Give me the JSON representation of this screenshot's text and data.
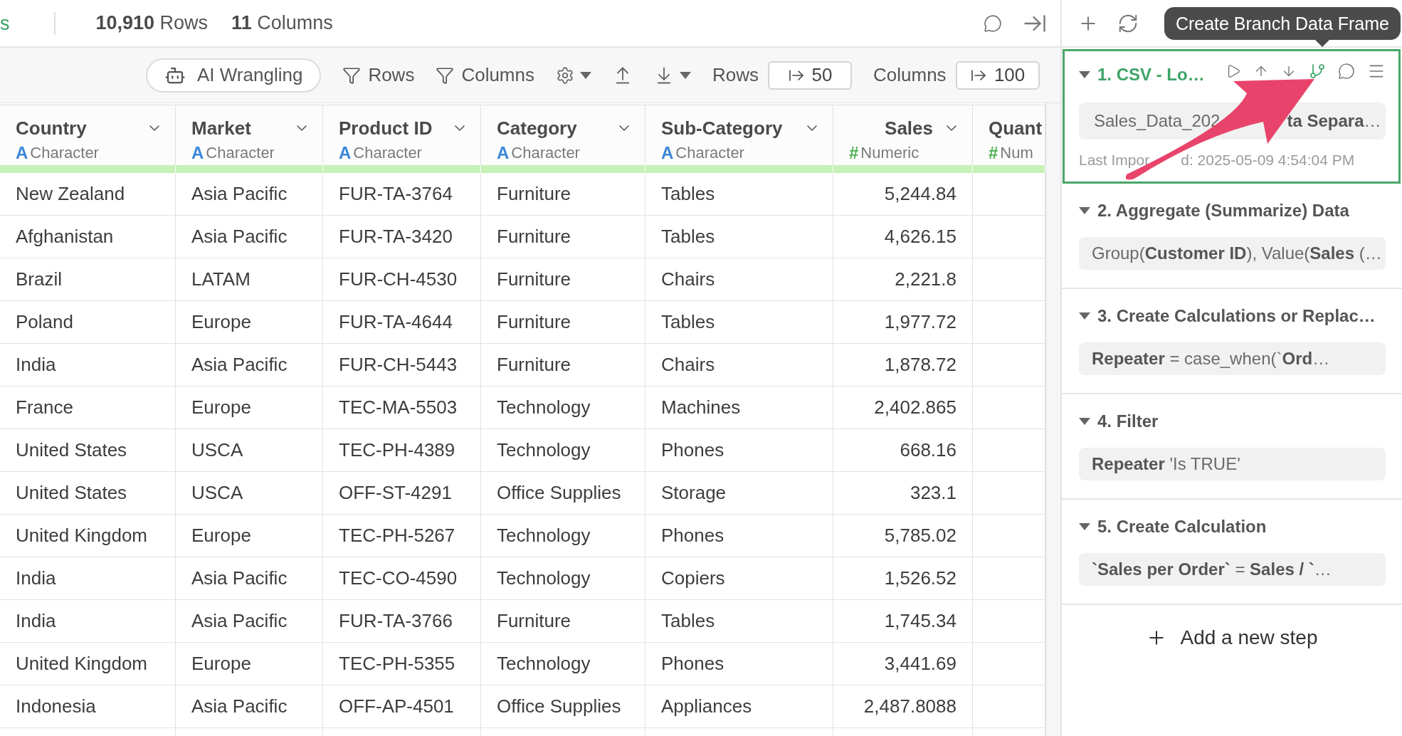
{
  "top_bar": {
    "cut_tab_label": "s",
    "rows": "**10,910** Rows",
    "columns": "**11** Columns"
  },
  "toolbar": {
    "ai_button": "AI Wrangling",
    "row_filter": "Rows",
    "column_filter": "Columns",
    "rows_limit_label": "Rows",
    "rows_limit": "50",
    "columns_limit_label": "Columns",
    "columns_limit": "100"
  },
  "table": {
    "columns": [
      {
        "name": "Country",
        "type": "Character",
        "symbol": "A",
        "kind": "character",
        "menu": true
      },
      {
        "name": "Market",
        "type": "Character",
        "symbol": "A",
        "kind": "character",
        "menu": true
      },
      {
        "name": "Product ID",
        "type": "Character",
        "symbol": "A",
        "kind": "character",
        "menu": true
      },
      {
        "name": "Category",
        "type": "Character",
        "symbol": "A",
        "kind": "character",
        "menu": true
      },
      {
        "name": "Sub-Category",
        "type": "Character",
        "symbol": "A",
        "kind": "character",
        "menu": true
      },
      {
        "name": "Sales",
        "type": "Numeric",
        "symbol": "#",
        "kind": "numeric",
        "menu": true
      },
      {
        "name": "Quant",
        "type": "Num",
        "symbol": "#",
        "kind": "numeric",
        "menu": false
      }
    ],
    "rows": [
      [
        "New Zealand",
        "Asia Pacific",
        "FUR-TA-3764",
        "Furniture",
        "Tables",
        "5,244.84"
      ],
      [
        "Afghanistan",
        "Asia Pacific",
        "FUR-TA-3420",
        "Furniture",
        "Tables",
        "4,626.15"
      ],
      [
        "Brazil",
        "LATAM",
        "FUR-CH-4530",
        "Furniture",
        "Chairs",
        "2,221.8"
      ],
      [
        "Poland",
        "Europe",
        "FUR-TA-4644",
        "Furniture",
        "Tables",
        "1,977.72"
      ],
      [
        "India",
        "Asia Pacific",
        "FUR-CH-5443",
        "Furniture",
        "Chairs",
        "1,878.72"
      ],
      [
        "France",
        "Europe",
        "TEC-MA-5503",
        "Technology",
        "Machines",
        "2,402.865"
      ],
      [
        "United States",
        "USCA",
        "TEC-PH-4389",
        "Technology",
        "Phones",
        "668.16"
      ],
      [
        "United States",
        "USCA",
        "OFF-ST-4291",
        "Office Supplies",
        "Storage",
        "323.1"
      ],
      [
        "United Kingdom",
        "Europe",
        "TEC-PH-5267",
        "Technology",
        "Phones",
        "5,785.02"
      ],
      [
        "India",
        "Asia Pacific",
        "TEC-CO-4590",
        "Technology",
        "Copiers",
        "1,526.52"
      ],
      [
        "India",
        "Asia Pacific",
        "FUR-TA-3766",
        "Furniture",
        "Tables",
        "1,745.34"
      ],
      [
        "United Kingdom",
        "Europe",
        "TEC-PH-5355",
        "Technology",
        "Phones",
        "3,441.69"
      ],
      [
        "Indonesia",
        "Asia Pacific",
        "OFF-AP-4501",
        "Office Supplies",
        "Appliances",
        "2,487.8088"
      ]
    ]
  },
  "steps_panel": {
    "tooltip": "Create Branch Data Frame",
    "steps": [
      {
        "title": "1. CSV - Lo…",
        "expanded": true,
        "selected": true,
        "summary_parts": [
          "Sales_Data_202",
          "**ta Separa**…"
        ],
        "meta_parts": [
          "Last Impor",
          "d: 2025-05-09 4:54:04 PM"
        ]
      },
      {
        "title": "2. Aggregate (Summarize) Data",
        "expanded": true,
        "selected": false,
        "summary_parts": [
          "Group(**Customer ID**), Value(**Sales** (…"
        ]
      },
      {
        "title": "3. Create Calculations or Replac…",
        "expanded": true,
        "selected": false,
        "summary_parts": [
          "**Repeater** = case_when(`**Ord**…"
        ]
      },
      {
        "title": "4. Filter",
        "expanded": true,
        "selected": false,
        "summary_parts": [
          "**Repeater** 'Is TRUE'"
        ]
      },
      {
        "title": "5. Create Calculation",
        "expanded": true,
        "selected": false,
        "summary_parts": [
          "**`Sales per Order`** = **Sales / `**…"
        ]
      }
    ],
    "add_step": "Add a new step"
  }
}
